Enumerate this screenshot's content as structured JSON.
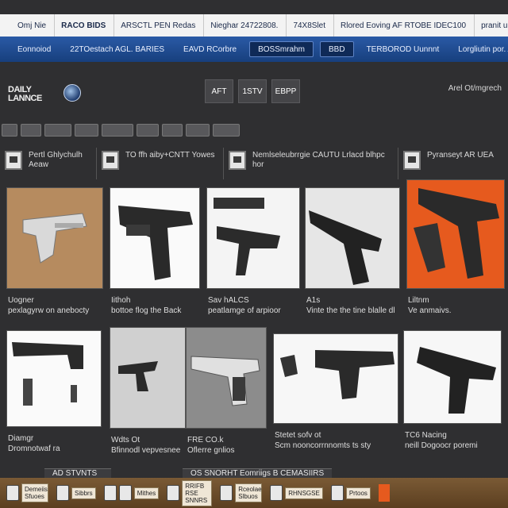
{
  "topbar": {
    "items": [
      "Omj Nie",
      "RACO BIDS",
      "ARSCTL PEN Redas",
      "Nieghar 24722808.",
      "74X8Slet",
      "Rlored Eoving AF RTOBE IDEC100",
      "pranit urrd U"
    ]
  },
  "navbar": {
    "items": [
      "Eonnoiod",
      "22TOestach AGL. BARIES",
      "EAVD RCorbre",
      "BOSSmrahm",
      "BBD",
      "TERBOROD Uunnnt",
      "Lorgliutin por. Aenig"
    ]
  },
  "header": {
    "logo": "DAILY LANNCE",
    "buttons": [
      "AFT",
      "1STV",
      "ЕВРР"
    ],
    "right_link": "Arel Ot/mgrech"
  },
  "categories": [
    {
      "label": "Pertl Ghlychulh Aeaw"
    },
    {
      "label": "TO ffh aiby+CNTT Yowes"
    },
    {
      "label": "Nemlseleubrrgie CAUTU Lrlacd blhpc hor"
    },
    {
      "label": "Pyranseyt AR UEA"
    }
  ],
  "gallery": {
    "row1": [
      {
        "title": "Uogner",
        "desc": "pexlagyrw on anebocty"
      },
      {
        "title": "Iithoh",
        "desc": "bottoe flog the Back"
      },
      {
        "title": "Sav hALCS",
        "desc": "peatlamge of arpioor"
      },
      {
        "title": "A1s",
        "desc": "Vinte the the tine blalle dl"
      },
      {
        "title": "Liltnm",
        "desc": "Ve anmaivs."
      }
    ],
    "row2": [
      {
        "title": "Diamgr",
        "desc": "Dromnotwaf ra"
      },
      {
        "title": "Wdts Ot",
        "desc": "Bfinnodl vepvesnee"
      },
      {
        "title": "FRE CO.k",
        "desc": "Oflerre gnlios"
      },
      {
        "title": "Stetet sofv ot",
        "desc": "Scm nooncorrnnomts ts sty"
      },
      {
        "title": "TC6 Nacing",
        "desc": "neill Dogoocr poremi"
      }
    ]
  },
  "bottom_tabs": [
    "AD STVNTS",
    "OS SNORHT Eomriigs B CEMASIIRS"
  ],
  "taskbar": {
    "items": [
      {
        "label": "Demeiis Sfuoes"
      },
      {
        "label": "Sibbrs"
      },
      {
        "label": "Mithes"
      },
      {
        "label": "RRIFB RSE SNNRS"
      },
      {
        "label": "Rceolae Slbuos"
      },
      {
        "label": "RHNSGSE"
      },
      {
        "label": "Prtoos"
      }
    ]
  },
  "colors": {
    "page_bg": "#2f2f31",
    "nav_blue": "#1f4c92",
    "taskbar_brown": "#6b4c2a",
    "accent_orange": "#e65a1e"
  }
}
